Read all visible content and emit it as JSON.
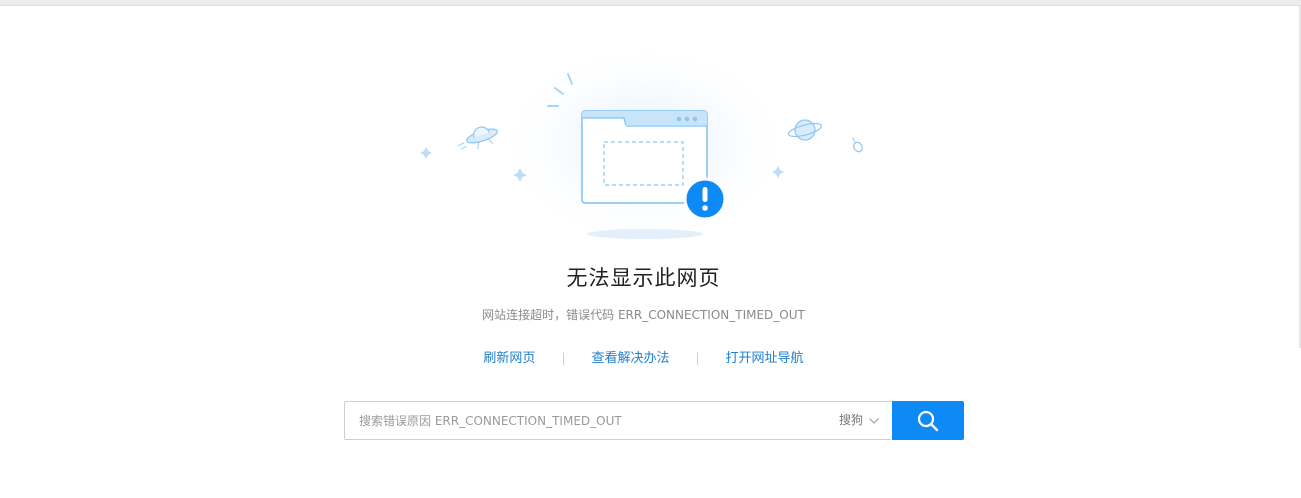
{
  "error": {
    "title": "无法显示此网页",
    "subtitle": "网站连接超时，错误代码 ERR_CONNECTION_TIMED_OUT"
  },
  "actions": {
    "refresh": "刷新网页",
    "solutions": "查看解决办法",
    "nav": "打开网址导航",
    "separator": "|"
  },
  "search": {
    "placeholder": "搜索错误原因 ERR_CONNECTION_TIMED_OUT",
    "engine": "搜狗"
  },
  "colors": {
    "accent": "#0d8af5",
    "link": "#1f7ed0",
    "illustration_light": "#cfe7fb",
    "illustration_stroke": "#6bb7f2"
  }
}
